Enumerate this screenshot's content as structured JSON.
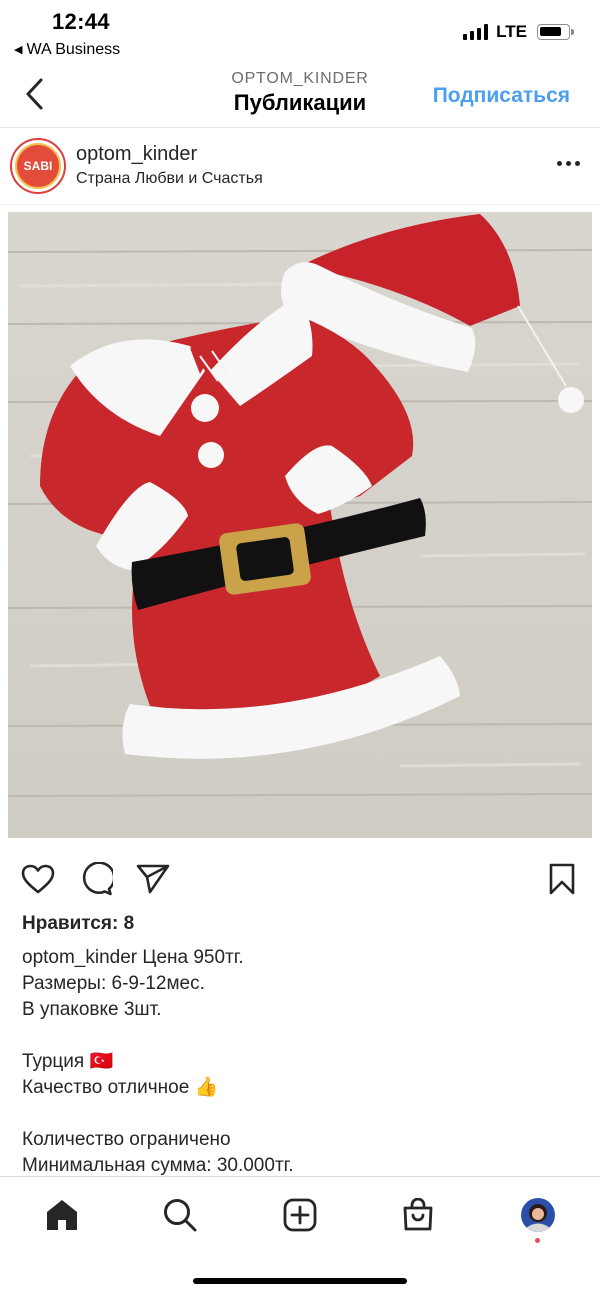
{
  "status_bar": {
    "time": "12:44",
    "back_app": "WA Business",
    "network": "LTE",
    "signal_icon": "cellular-signal-icon",
    "battery_icon": "battery-icon"
  },
  "header": {
    "subtitle": "OPTOM_KINDER",
    "title": "Публикации",
    "follow_label": "Подписаться",
    "back_icon": "chevron-left-icon",
    "accent_color": "#4b9ef0"
  },
  "post": {
    "avatar_text": "SABI",
    "username": "optom_kinder",
    "location": "Страна Любви и Счастья",
    "more_icon": "more-dots-icon",
    "image_alt_icon": "photo",
    "likes_text": "Нравится: 8",
    "caption": {
      "username": "optom_kinder",
      "lines": [
        "Цена 950тг.",
        "Размеры: 6-9-12мес.",
        "В упаковке 3шт.",
        "",
        "Турция",
        "Качество отличное",
        "",
        "Количество ограничено",
        "Минимальная сумма: 30.000тг."
      ],
      "emoji_flag": "🇹🇷",
      "emoji_thumb": "👍"
    },
    "actions": [
      "heart-icon",
      "comment-icon",
      "share-icon",
      "bookmark-icon"
    ]
  },
  "tab_bar": {
    "tabs": [
      "home-icon",
      "search-icon",
      "create-icon",
      "shop-icon",
      "profile-avatar"
    ]
  }
}
